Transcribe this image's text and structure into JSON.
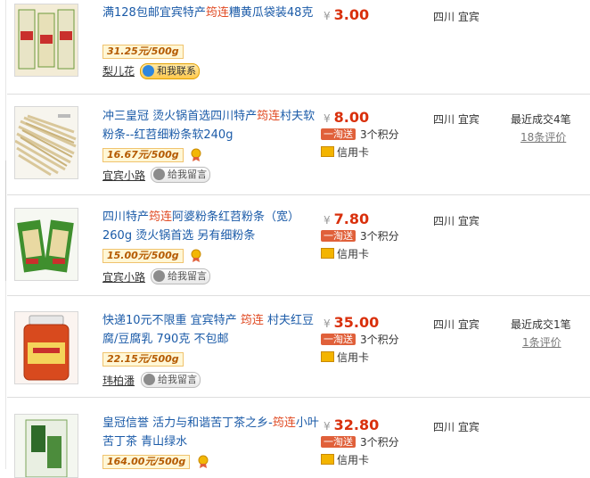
{
  "products": [
    {
      "title_parts": [
        "满128包邮宜宾特产",
        "筠连",
        "糟黄瓜袋装48克"
      ],
      "unit_price": "31.25元/500g",
      "seller": "梨儿花",
      "contact_label": "和我联系",
      "price": "3.00",
      "location": "四川 宜宾"
    },
    {
      "title_parts": [
        "冲三皇冠 烫火锅首选四川特产",
        "筠连",
        "村夫软粉条--红苕细粉条软240g"
      ],
      "unit_price": "16.67元/500g",
      "seller": "宜宾小路",
      "contact_label": "给我留言",
      "price": "8.00",
      "promo": "一淘送",
      "points": "3个积分",
      "card": "信用卡",
      "location": "四川 宜宾",
      "sold": "最近成交4笔",
      "reviews": "18条评价"
    },
    {
      "title_parts": [
        "四川特产",
        "筠连",
        "阿婆粉条红苕粉条（宽）260g 烫火锅首选 另有细粉条"
      ],
      "unit_price": "15.00元/500g",
      "seller": "宜宾小路",
      "contact_label": "给我留言",
      "price": "7.80",
      "promo": "一淘送",
      "points": "3个积分",
      "card": "信用卡",
      "location": "四川 宜宾"
    },
    {
      "title_parts": [
        "快递10元不限重 宜宾特产 ",
        "筠连",
        " 村夫红豆腐/豆腐乳 790克 不包邮"
      ],
      "unit_price": "22.15元/500g",
      "seller": "玮柏潘",
      "contact_label": "给我留言",
      "price": "35.00",
      "promo": "一淘送",
      "points": "3个积分",
      "card": "信用卡",
      "location": "四川 宜宾",
      "sold": "最近成交1笔",
      "reviews": "1条评价"
    },
    {
      "title_parts": [
        "皇冠信誉 活力与和谐苦丁茶之乡-",
        "筠连",
        "小叶苦丁茶 青山绿水"
      ],
      "unit_price": "164.00元/500g",
      "price": "32.80",
      "promo": "一淘送",
      "points": "3个积分",
      "card": "信用卡",
      "location": "四川 宜宾"
    }
  ],
  "currency_symbol": "¥",
  "colors": {
    "link": "#1b5ba8",
    "highlight": "#e04b24",
    "price": "#d9300c",
    "promo": "#e0603a"
  }
}
